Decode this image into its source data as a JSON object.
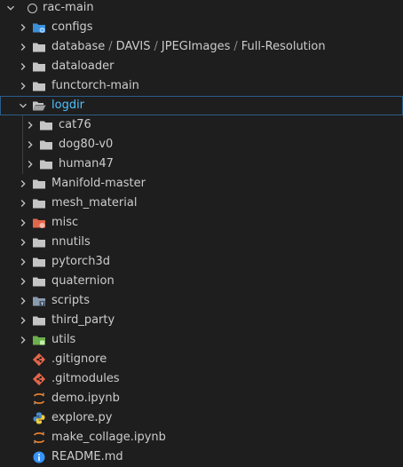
{
  "explorer": {
    "root": {
      "label": "rac-main"
    },
    "colors": {
      "folder": "#c5c5c5",
      "folder_configs": "#3b8fd9",
      "folder_misc": "#e2664a",
      "folder_utils": "#6cb04c",
      "git": "#e2664a",
      "jupyter": "#f0842e",
      "python_blue": "#4a8ccf",
      "python_yellow": "#f2cd40",
      "info": "#3794ff",
      "selected_text": "#4fc1ff"
    },
    "items": [
      {
        "label": "configs",
        "icon": "folder-gear-icon"
      },
      {
        "label": "database",
        "icon": "folder-icon",
        "path": [
          "DAVIS",
          "JPEGImages",
          "Full-Resolution"
        ]
      },
      {
        "label": "dataloader",
        "icon": "folder-icon"
      },
      {
        "label": "functorch-main",
        "icon": "folder-icon"
      },
      {
        "label": "logdir",
        "icon": "folder-open-icon",
        "expanded": true,
        "selected": true
      },
      {
        "label": "cat76",
        "icon": "folder-icon"
      },
      {
        "label": "dog80-v0",
        "icon": "folder-icon"
      },
      {
        "label": "human47",
        "icon": "folder-icon"
      },
      {
        "label": "Manifold-master",
        "icon": "folder-icon"
      },
      {
        "label": "mesh_material",
        "icon": "folder-icon"
      },
      {
        "label": "misc",
        "icon": "folder-misc-icon"
      },
      {
        "label": "nnutils",
        "icon": "folder-icon"
      },
      {
        "label": "pytorch3d",
        "icon": "folder-icon"
      },
      {
        "label": "quaternion",
        "icon": "folder-icon"
      },
      {
        "label": "scripts",
        "icon": "folder-scripts-icon"
      },
      {
        "label": "third_party",
        "icon": "folder-icon"
      },
      {
        "label": "utils",
        "icon": "folder-utils-icon"
      },
      {
        "label": ".gitignore",
        "icon": "git-icon"
      },
      {
        "label": ".gitmodules",
        "icon": "git-icon"
      },
      {
        "label": "demo.ipynb",
        "icon": "jupyter-icon"
      },
      {
        "label": "explore.py",
        "icon": "python-icon"
      },
      {
        "label": "make_collage.ipynb",
        "icon": "jupyter-icon"
      },
      {
        "label": "README.md",
        "icon": "info-icon"
      }
    ]
  }
}
